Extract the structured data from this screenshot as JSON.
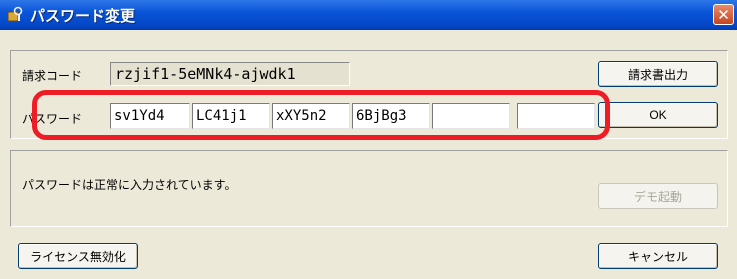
{
  "window": {
    "title": "パスワード変更",
    "close_label": "✕"
  },
  "request_code": {
    "label": "請求コード",
    "value": "rzjif1-5eMNk4-ajwdk1"
  },
  "password": {
    "label": "パスワード",
    "fields": [
      "sv1Yd4",
      "LC41j1",
      "xXY5n2",
      "6BjBg3",
      "",
      ""
    ]
  },
  "buttons": {
    "invoice_output": "請求書出力",
    "ok": "OK",
    "demo_launch": "デモ起動",
    "license_disable": "ライセンス無効化",
    "cancel": "キャンセル"
  },
  "status_message": "パスワードは正常に入力されています。",
  "colors": {
    "title_bar": "#0a55d8",
    "highlight": "#ee1c25",
    "background": "#ece9d8"
  },
  "icons": {
    "app": "key-lock-icon",
    "close": "close-icon"
  }
}
